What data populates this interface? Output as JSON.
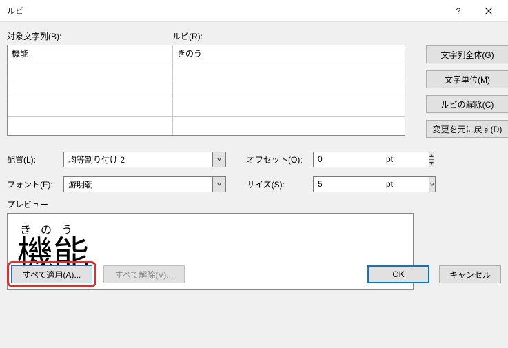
{
  "title": "ルビ",
  "labels": {
    "base_text": "対象文字列(B):",
    "ruby": "ルビ(R):",
    "align": "配置(L):",
    "font": "フォント(F):",
    "offset": "オフセット(O):",
    "size": "サイズ(S):",
    "pt1": "pt",
    "pt2": "pt",
    "preview": "プレビュー"
  },
  "side_buttons": {
    "group": "文字列全体(G)",
    "mono": "文字単位(M)",
    "clear": "ルビの解除(C)",
    "reset": "変更を元に戻す(D)"
  },
  "grid": {
    "r0c0": "機能",
    "r0c1": "きのう"
  },
  "fields": {
    "align": "均等割り付け 2",
    "font": "游明朝",
    "offset": "0",
    "size": "5"
  },
  "preview": {
    "ruby": "きのう",
    "base": "機能"
  },
  "buttons": {
    "apply_all": "すべて適用(A)...",
    "remove_all": "すべて解除(V)...",
    "ok": "OK",
    "cancel": "キャンセル"
  }
}
